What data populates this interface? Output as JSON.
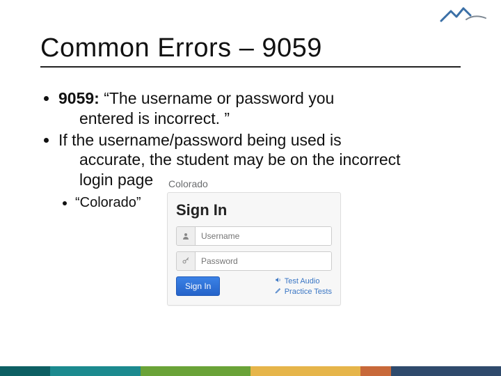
{
  "title": "Common Errors – 9059",
  "bullets": {
    "b1_label": "9059:",
    "b1_rest": " “The username or password you ",
    "b1_line2": "entered is incorrect. ”",
    "b2_line1": "If the username/password being used is ",
    "b2_line2": "accurate, the student may be on the incorrect ",
    "b2_line3": "login page",
    "sub1": "“Colorado”"
  },
  "signin": {
    "brand": "Colorado",
    "heading": "Sign In",
    "username_placeholder": "Username",
    "password_placeholder": "Password",
    "button": "Sign In",
    "link_test_audio": "Test Audio",
    "link_practice": "Practice Tests"
  }
}
